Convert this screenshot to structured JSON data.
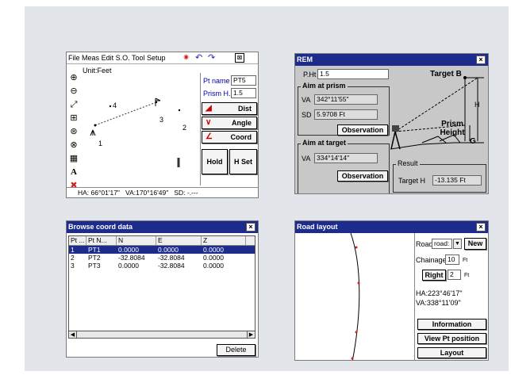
{
  "screen1": {
    "menu": [
      "File",
      "Meas",
      "Edit",
      "S.O.",
      "Tool",
      "Setup"
    ],
    "unit_label": "Unit:Feet",
    "points": [
      "4",
      "3",
      "2",
      "1"
    ],
    "pt_name_label": "Pt name",
    "pt_name_value": "PT5",
    "prism_h_label": "Prism H.",
    "prism_h_value": "1.5",
    "dist_label": "Dist",
    "angle_label": "Angle",
    "coord_label": "Coord",
    "hold_label": "Hold",
    "hset_label": "H Set",
    "status_ha": "HA: 66°01'17\"",
    "status_va": "VA:170°16'49\"",
    "status_sd": "SD:   -.---"
  },
  "screen2": {
    "title": "REM",
    "pht_label": "P.Ht",
    "pht_value": "1.5",
    "aim_prism_label": "Aim at prism",
    "va_label": "VA",
    "va_value": "342°11'55\"",
    "sd_label": "SD",
    "sd_value": "5.9708 Ft",
    "observation_label": "Observation",
    "aim_target_label": "Aim at target",
    "va2_label": "VA",
    "va2_value": "334°14'14\"",
    "observation2_label": "Observation",
    "target_b_label": "Target B",
    "prism_height_label": "Prism Height",
    "h_label": "H",
    "g_label": "G",
    "result_label": "Result",
    "target_h_label": "Target H",
    "target_h_value": "-13.135 Ft"
  },
  "screen3": {
    "title": "Browse coord data",
    "headers": [
      "Pt ...",
      "Pt N...",
      "N",
      "E",
      "Z"
    ],
    "rows": [
      [
        "1",
        "PT1",
        "0.0000",
        "0.0000",
        "0.0000"
      ],
      [
        "2",
        "PT2",
        "-32.8084",
        "-32.8084",
        "0.0000"
      ],
      [
        "3",
        "PT3",
        "0.0000",
        "-32.8084",
        "0.0000"
      ]
    ],
    "delete_label": "Delete"
  },
  "screen4": {
    "title": "Road layout",
    "road_label": "Road",
    "road_value": "road:",
    "new_label": "New",
    "chainage_label": "Chainage",
    "chainage_value": "10",
    "chainage_unit": "Ft",
    "right_label": "Right",
    "right_value": "2",
    "right_unit": "Ft",
    "ha_text": "HA:223°46'17\"",
    "va_text": "VA:338°11'09\"",
    "information_label": "Information",
    "view_pt_label": "View Pt position",
    "layout_label": "Layout"
  }
}
